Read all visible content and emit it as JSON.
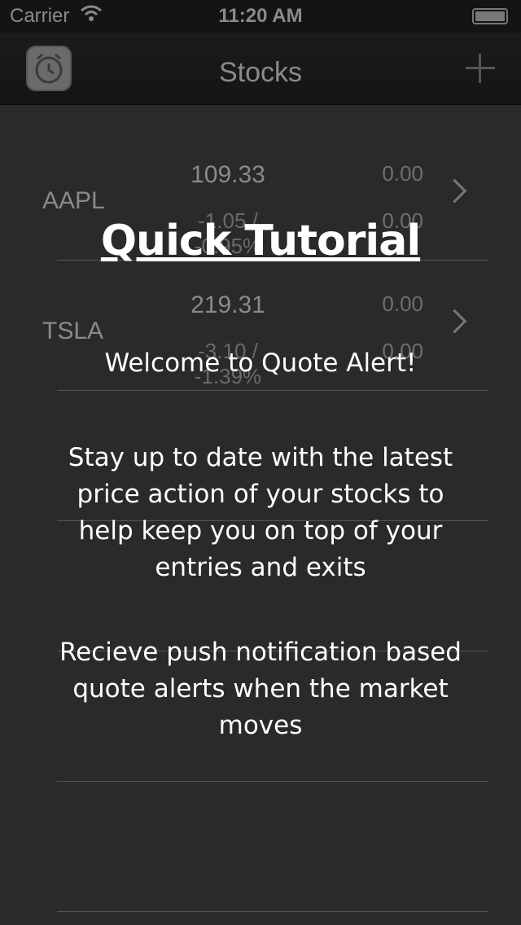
{
  "status_bar": {
    "carrier": "Carrier",
    "time": "11:20 AM"
  },
  "nav": {
    "title": "Stocks",
    "app_icon": "alarm-clock-icon",
    "add_icon": "plus-icon"
  },
  "stocks": [
    {
      "symbol": "AAPL",
      "price": "109.33",
      "change": "-1.05  /  -0.95%",
      "alert_high": "0.00",
      "alert_low": "0.00"
    },
    {
      "symbol": "TSLA",
      "price": "219.31",
      "change": "-3.10  /  -1.39%",
      "alert_high": "0.00",
      "alert_low": "0.00"
    }
  ],
  "tutorial": {
    "title": "Quick Tutorial",
    "welcome": "Welcome to Quote Alert!",
    "paragraph1": "Stay up to date with the latest price action of your stocks to help keep you on top of your entries and exits",
    "paragraph2": "Recieve push notification based quote alerts when the market moves"
  }
}
